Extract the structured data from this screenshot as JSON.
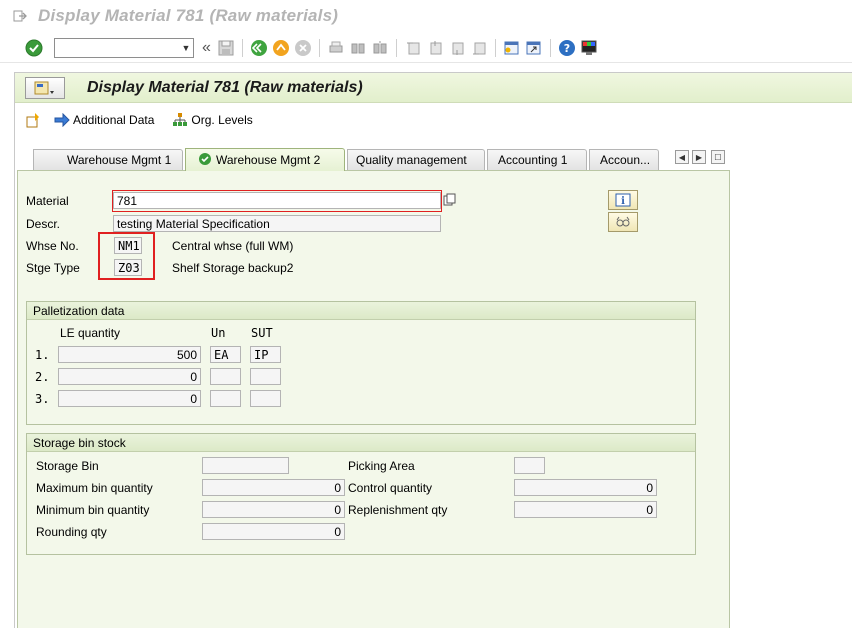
{
  "window": {
    "title": "Display Material 781 (Raw materials)"
  },
  "toolbar": {
    "command_placeholder": "",
    "icons": [
      "enter-icon",
      "save-icon",
      "back-icon",
      "exit-icon",
      "cancel-icon",
      "print-icon",
      "find-icon",
      "find-next-icon",
      "first-page-icon",
      "prev-page-icon",
      "next-page-icon",
      "last-page-icon",
      "new-session-icon",
      "shortcut-icon",
      "help-icon",
      "layout-icon"
    ]
  },
  "app": {
    "title": "Display Material 781 (Raw materials)",
    "additional_data_label": "Additional Data",
    "org_levels_label": "Org. Levels"
  },
  "tabs": [
    {
      "label": "Warehouse Mgmt 1"
    },
    {
      "label": "Warehouse Mgmt 2"
    },
    {
      "label": "Quality management"
    },
    {
      "label": "Accounting 1"
    },
    {
      "label": "Accoun..."
    }
  ],
  "header": {
    "material_label": "Material",
    "material_value": "781",
    "descr_label": "Descr.",
    "descr_value": "testing Material Specification",
    "whse_label": "Whse No.",
    "whse_value": "NM1",
    "whse_desc": "Central whse (full WM)",
    "stge_label": "Stge Type",
    "stge_value": "Z03",
    "stge_desc": "Shelf Storage backup2"
  },
  "palletization": {
    "title": "Palletization data",
    "col_le": "LE quantity",
    "col_un": "Un",
    "col_sut": "SUT",
    "rows": [
      {
        "num": "1.",
        "qty": "500",
        "un": "EA",
        "sut": "IP"
      },
      {
        "num": "2.",
        "qty": "0",
        "un": "",
        "sut": ""
      },
      {
        "num": "3.",
        "qty": "0",
        "un": "",
        "sut": ""
      }
    ]
  },
  "storage_bin": {
    "title": "Storage bin stock",
    "storage_bin_label": "Storage Bin",
    "storage_bin_value": "",
    "picking_area_label": "Picking Area",
    "picking_area_value": "",
    "max_bin_label": "Maximum bin quantity",
    "max_bin_value": "0",
    "control_qty_label": "Control quantity",
    "control_qty_value": "0",
    "min_bin_label": "Minimum bin quantity",
    "min_bin_value": "0",
    "replenishment_label": "Replenishment qty",
    "replenishment_value": "0",
    "rounding_label": "Rounding qty",
    "rounding_value": "0"
  }
}
